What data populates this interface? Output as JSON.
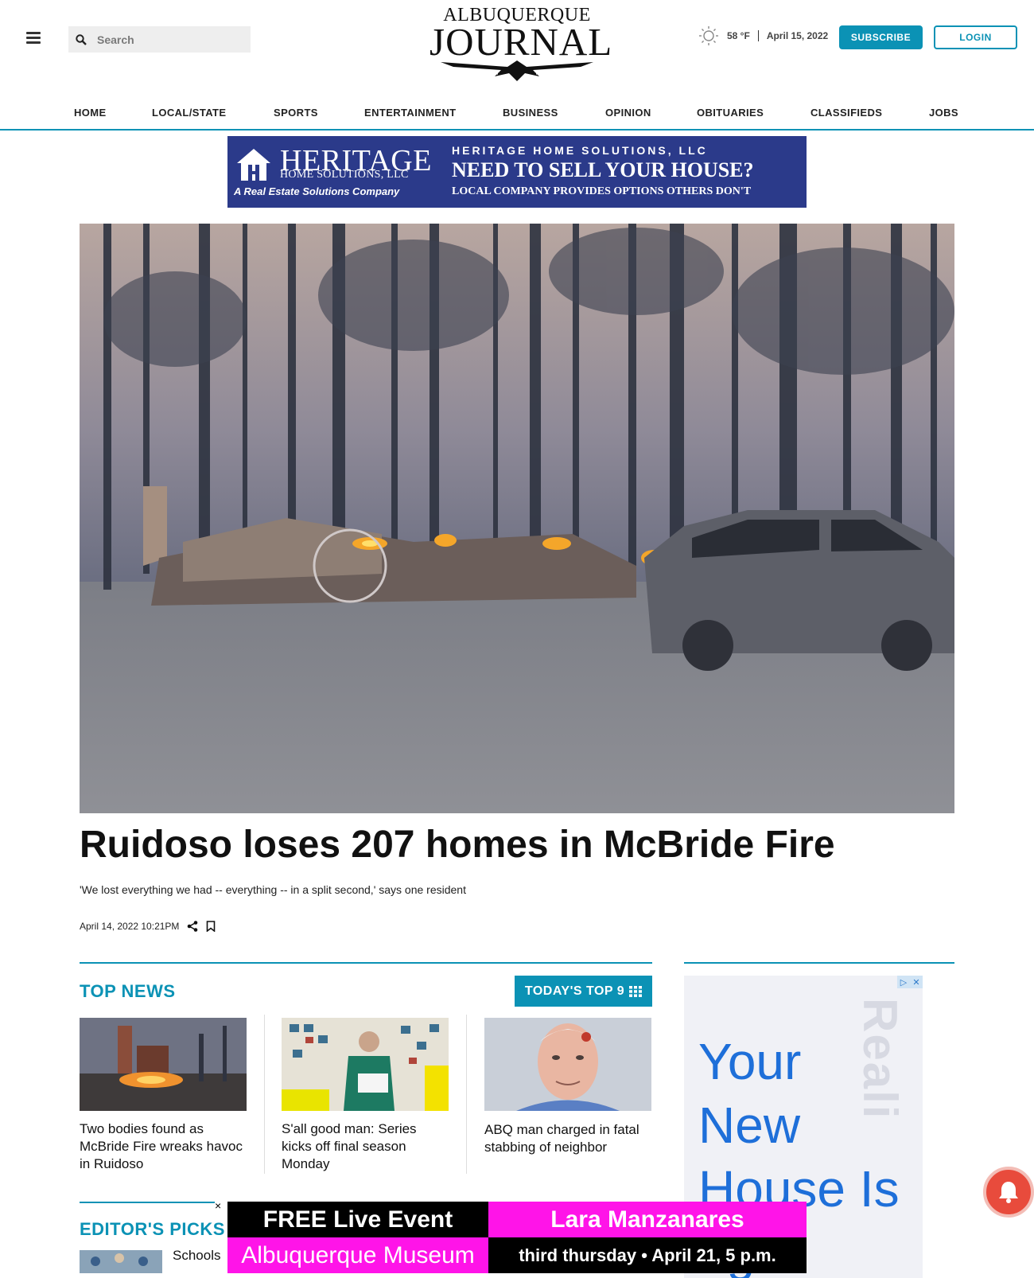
{
  "header": {
    "search_placeholder": "Search",
    "logo_line1": "ALBUQUERQUE",
    "logo_line2": "JOURNAL",
    "temperature": "58 °F",
    "date": "April 15, 2022",
    "subscribe_label": "SUBSCRIBE",
    "login_label": "LOGIN"
  },
  "nav": {
    "items": [
      "HOME",
      "LOCAL/STATE",
      "SPORTS",
      "ENTERTAINMENT",
      "BUSINESS",
      "OPINION",
      "OBITUARIES",
      "CLASSIFIEDS",
      "JOBS"
    ]
  },
  "banner_ad": {
    "brand": "HERITAGE",
    "brand_sub": "HOME SOLUTIONS, LLC",
    "tagline": "A Real Estate Solutions Company",
    "right_line1": "HERITAGE HOME SOLUTIONS, LLC",
    "right_line2": "NEED TO SELL YOUR HOUSE?",
    "right_line3": "LOCAL COMPANY PROVIDES OPTIONS OTHERS DON'T"
  },
  "article": {
    "headline": "Ruidoso loses 207 homes in McBride Fire",
    "dek": "'We lost everything we had -- everything -- in a split second,' says one resident",
    "timestamp": "April 14, 2022 10:21PM"
  },
  "top_news": {
    "title": "TOP NEWS",
    "top9_label": "TODAY'S TOP 9",
    "stories": [
      {
        "title": "Two bodies found as McBride Fire wreaks havoc in Ruidoso"
      },
      {
        "title": "S'all good man: Series kicks off final season Monday"
      },
      {
        "title": "ABQ man charged in fatal stabbing of neighbor"
      }
    ]
  },
  "editors_picks": {
    "title": "EDITOR'S PICKS",
    "first_story_partial": "Schools"
  },
  "side_ad": {
    "headline": "Your New House Is",
    "headline_partial": "ng",
    "watermark": "Reali"
  },
  "sticky_ad": {
    "close_label": "×",
    "cell1": "FREE Live Event",
    "cell2": "Lara Manzanares",
    "cell3": "Albuquerque Museum",
    "cell4": "third thursday • April 21, 5 p.m."
  },
  "colors": {
    "accent": "#0b92b5",
    "ad_blue": "#2b3a8a",
    "magenta": "#ff14e8",
    "notify_red": "#e84b3c"
  }
}
